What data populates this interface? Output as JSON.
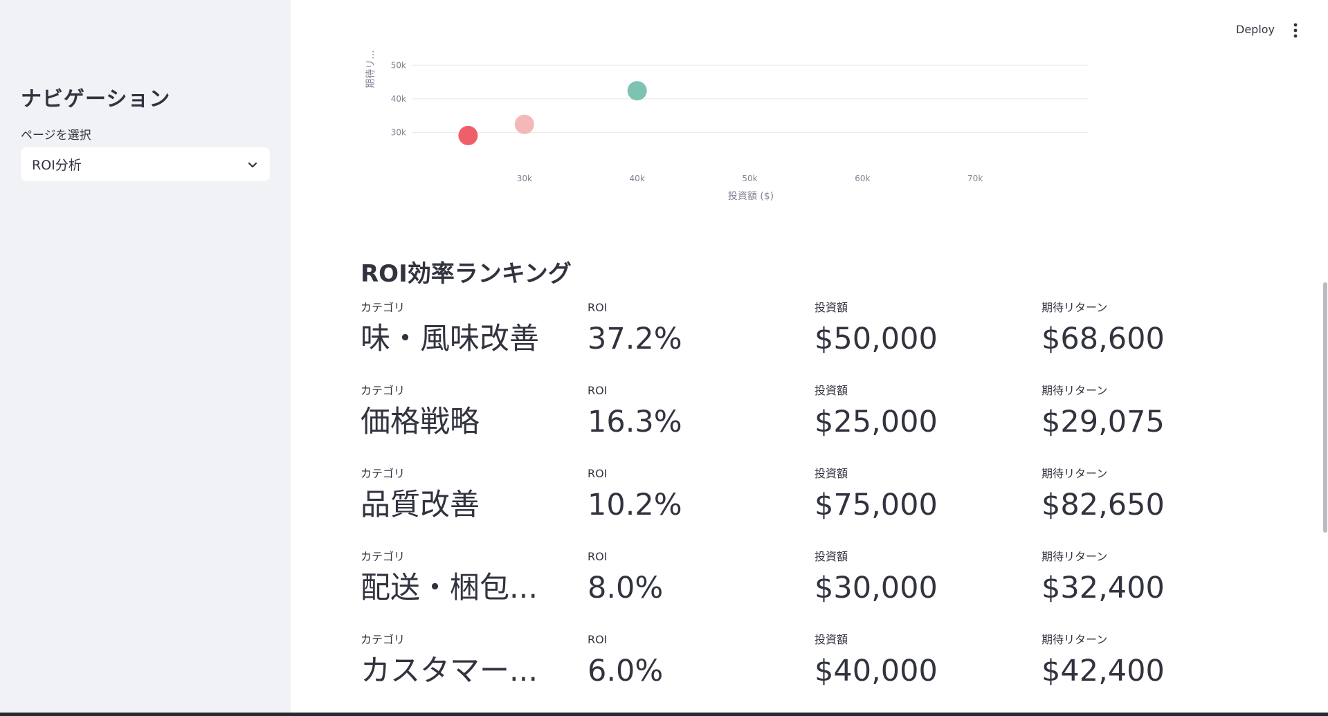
{
  "sidebar": {
    "title": "ナビゲーション",
    "select_label": "ページを選択",
    "selected_page": "ROI分析"
  },
  "topbar": {
    "deploy_label": "Deploy",
    "menu_icon": "more-vert-icon"
  },
  "chart_data": {
    "type": "scatter",
    "xlabel": "投資額 ($)",
    "ylabel": "期待リ...",
    "xlim": [
      20000,
      80000
    ],
    "ylim": [
      20000,
      55000
    ],
    "x_ticks": [
      "30k",
      "40k",
      "50k",
      "60k",
      "70k"
    ],
    "x_tick_values": [
      30000,
      40000,
      50000,
      60000,
      70000
    ],
    "y_ticks": [
      "30k",
      "40k",
      "50k"
    ],
    "y_tick_values": [
      30000,
      40000,
      50000
    ],
    "points": [
      {
        "x": 25000,
        "y": 29075,
        "color": "#ef5f67"
      },
      {
        "x": 30000,
        "y": 32400,
        "color": "#f4b8b8"
      },
      {
        "x": 40000,
        "y": 42400,
        "color": "#7cc3b2"
      }
    ]
  },
  "ranking": {
    "title": "ROI効率ランキング",
    "labels": {
      "category": "カテゴリ",
      "roi": "ROI",
      "investment": "投資額",
      "expected_return": "期待リターン"
    },
    "rows": [
      {
        "category": "味・風味改善",
        "roi": "37.2%",
        "investment": "$50,000",
        "expected_return": "$68,600"
      },
      {
        "category": "価格戦略",
        "roi": "16.3%",
        "investment": "$25,000",
        "expected_return": "$29,075"
      },
      {
        "category": "品質改善",
        "roi": "10.2%",
        "investment": "$75,000",
        "expected_return": "$82,650"
      },
      {
        "category": "配送・梱包...",
        "roi": "8.0%",
        "investment": "$30,000",
        "expected_return": "$32,400"
      },
      {
        "category": "カスタマー...",
        "roi": "6.0%",
        "investment": "$40,000",
        "expected_return": "$42,400"
      }
    ]
  }
}
